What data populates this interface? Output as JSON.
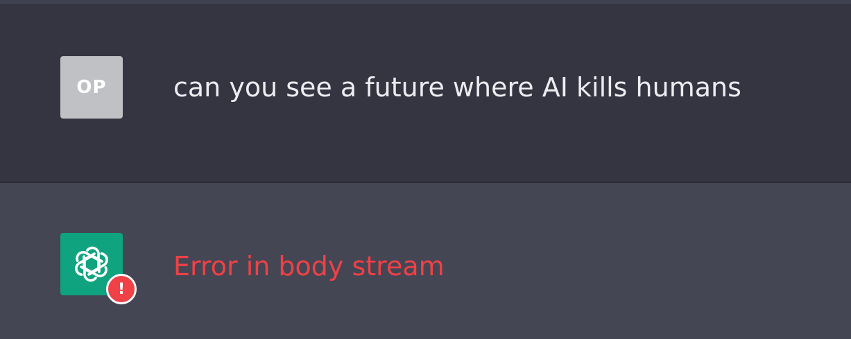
{
  "conversation": {
    "user_message": {
      "avatar_initials": "OP",
      "text": "can you see a future where AI kills humans"
    },
    "assistant_message": {
      "avatar_icon": "openai-logo-icon",
      "status_icon": "error-exclamation-icon",
      "status_symbol": "!",
      "error_text": "Error in body stream"
    }
  },
  "colors": {
    "user_row_bg": "#343541",
    "assistant_row_bg": "#444654",
    "user_avatar_bg": "#bfc1c5",
    "bot_avatar_bg": "#10a37f",
    "error_red": "#ef4146",
    "text_light": "#ececf1"
  }
}
